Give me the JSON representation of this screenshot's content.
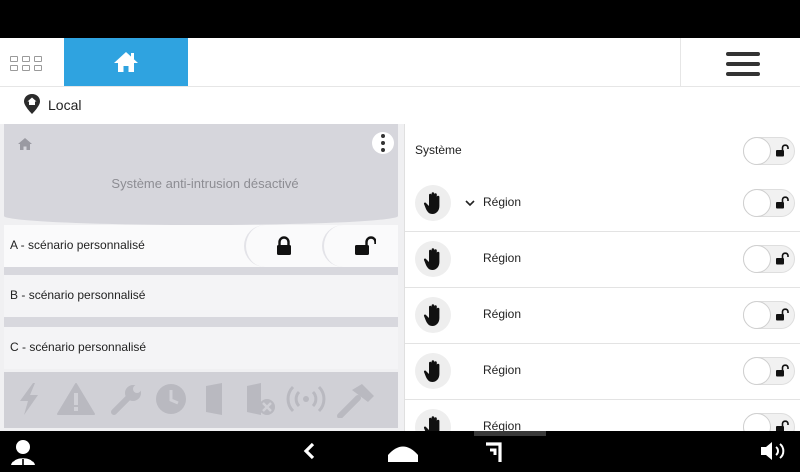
{
  "header": {
    "apps_icon": "grid-icon",
    "home_icon": "home-icon",
    "menu_icon": "hamburger-menu-icon"
  },
  "location": {
    "label": "Local",
    "icon": "location-pin-icon"
  },
  "left_panel": {
    "status": "Système anti-intrusion désactivé",
    "scenarios": [
      {
        "letter": "A",
        "label": "scénario personnalisé"
      },
      {
        "letter": "B",
        "label": "scénario personnalisé"
      },
      {
        "letter": "C",
        "label": "scénario personnalisé"
      }
    ],
    "status_icons": [
      "lightning-icon",
      "warning-icon",
      "wrench-icon",
      "clock-icon",
      "door-icon",
      "door-blocked-icon",
      "wireless-icon",
      "hammer-icon"
    ]
  },
  "right_panel": {
    "system_label": "Système",
    "regions": [
      {
        "label": "Région",
        "expandable": true
      },
      {
        "label": "Région"
      },
      {
        "label": "Région"
      },
      {
        "label": "Région"
      },
      {
        "label": "Région"
      }
    ]
  },
  "colors": {
    "accent": "#2fa3e0",
    "bar": "#000000",
    "panel": "#d6d6dc"
  }
}
